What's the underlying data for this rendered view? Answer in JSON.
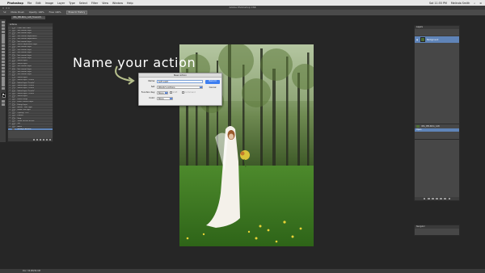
{
  "menubar": {
    "app": "Photoshop",
    "items": [
      "File",
      "Edit",
      "Image",
      "Layer",
      "Type",
      "Select",
      "Filter",
      "View",
      "Window",
      "Help"
    ],
    "right": {
      "day_time": "Sat 11:55 PM",
      "user": "Melinda Smith"
    }
  },
  "window": {
    "title": "Adobe Photoshop CS6"
  },
  "options": {
    "items": [
      "Mode: Brush",
      "Opacity: 100%",
      "Flow: 100%"
    ],
    "buttons": [
      "Erase to History"
    ]
  },
  "document": {
    "tab": "IMG_MELINDA_CAB_FAAAAVS"
  },
  "actions_panel": {
    "tab": "Actions",
    "rows": [
      {
        "label": "Color Tool Chart",
        "sel": false
      },
      {
        "label": "Set current layer",
        "sel": false
      },
      {
        "label": "Set current layer",
        "sel": false
      },
      {
        "label": "Set current adjustment",
        "sel": false
      },
      {
        "label": "Set current adjustment",
        "sel": false
      },
      {
        "label": "Set current layer",
        "sel": false
      },
      {
        "label": "Select adjustment layer",
        "sel": false
      },
      {
        "label": "Set current layer",
        "sel": false
      },
      {
        "label": "Set current layer",
        "sel": false
      },
      {
        "label": "Set current layer",
        "sel": false
      },
      {
        "label": "Set current layer",
        "sel": false
      },
      {
        "label": "Set current layer",
        "sel": false
      },
      {
        "label": "Select layer",
        "sel": false
      },
      {
        "label": "Select layer",
        "sel": false
      },
      {
        "label": "Set current layer",
        "sel": false
      },
      {
        "label": "Set current layer",
        "sel": false
      },
      {
        "label": "Set current layer",
        "sel": false
      },
      {
        "label": "Set current layer",
        "sel": false
      },
      {
        "label": "Select layer",
        "sel": false
      },
      {
        "label": "Select layer \"Levels\"",
        "sel": false
      },
      {
        "label": "Select layer \"Levels\"",
        "sel": false
      },
      {
        "label": "Select layer \"Levels\"",
        "sel": false
      },
      {
        "label": "Select layer \"Levels\"",
        "sel": false
      },
      {
        "label": "Select layer \"Levels\"",
        "sel": false
      },
      {
        "label": "Select layer \"Levels\"",
        "sel": false
      },
      {
        "label": "Select layer",
        "sel": false
      },
      {
        "label": "Make Group",
        "sel": false
      },
      {
        "label": "From: current layer",
        "sel": false
      },
      {
        "label": "Using: layer",
        "sel": false
      },
      {
        "label": "Name: \"Soft Light\"",
        "sel": false
      },
      {
        "label": "Mode: soft light",
        "sel": false
      },
      {
        "label": "Opacity: 70%",
        "sel": false
      },
      {
        "label": "Flatten",
        "sel": false
      },
      {
        "label": "Stop",
        "sel": false
      },
      {
        "label": "Show current action",
        "sel": false
      },
      {
        "label": "Set",
        "sel": false
      },
      {
        "label": "Basic",
        "sel": false
      },
      {
        "label": "Wendy's Actions",
        "sel": true
      }
    ]
  },
  "overlay": {
    "text": "Name your action"
  },
  "dialog": {
    "title": "New Action",
    "name_label": "Name:",
    "name_value": "Soft Light",
    "set_label": "Set:",
    "set_value": "Wendy's Actions",
    "fkey_label": "Function Key:",
    "fkey_value": "None",
    "shift_label": "Shift",
    "command_label": "Command",
    "color_label": "Color:",
    "color_value": "None",
    "record_button": "Record",
    "cancel_button": "Cancel"
  },
  "layers_panel": {
    "tab": "Layers",
    "layer_name": "Background"
  },
  "history_panel": {
    "rows": [
      {
        "label": "IMG_MELINDA_CAB",
        "sel": false
      },
      {
        "label": "Open",
        "sel": true
      }
    ]
  },
  "mini_panel": {
    "tab": "Navigator"
  },
  "status": {
    "text": "Doc: 34.9M/34.9M"
  },
  "colors": {
    "accent": "#5f84b8",
    "record": "#3d7ef0"
  }
}
